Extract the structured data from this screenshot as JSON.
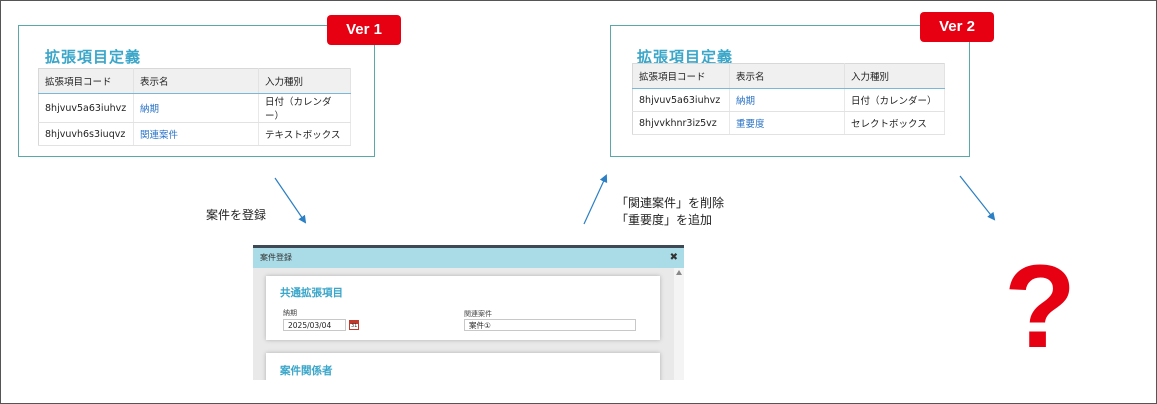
{
  "ver1": {
    "badge": "Ver 1",
    "title": "拡張項目定義",
    "headers": [
      "拡張項目コード",
      "表示名",
      "入力種別"
    ],
    "rows": [
      [
        "8hjvuv5a63iuhvz",
        "納期",
        "日付（カレンダー）"
      ],
      [
        "8hjvuvh6s3iuqvz",
        "関連案件",
        "テキストボックス"
      ]
    ]
  },
  "ver2": {
    "badge": "Ver 2",
    "title": "拡張項目定義",
    "headers": [
      "拡張項目コード",
      "表示名",
      "入力種別"
    ],
    "rows": [
      [
        "8hjvuv5a63iuhvz",
        "納期",
        "日付（カレンダー）"
      ],
      [
        "8hjvvkhnr3iz5vz",
        "重要度",
        "セレクトボックス"
      ]
    ]
  },
  "captions": {
    "register": "案件を登録",
    "change_line1": "「関連案件」を削除",
    "change_line2": "「重要度」を追加"
  },
  "dialog": {
    "title": "案件登録",
    "close_label": "✖",
    "section1_title": "共通拡張項目",
    "field1_label": "納期",
    "field1_value": "2025/03/04",
    "calendar_day": "31",
    "field2_label": "関連案件",
    "field2_value": "案件①",
    "section2_title": "案件関係者"
  },
  "result_symbol": "?",
  "colors": {
    "accent_red": "#e60012",
    "title_blue": "#3aa6c9",
    "panel_border": "#5aa9a8",
    "arrow": "#2b7fc4"
  }
}
